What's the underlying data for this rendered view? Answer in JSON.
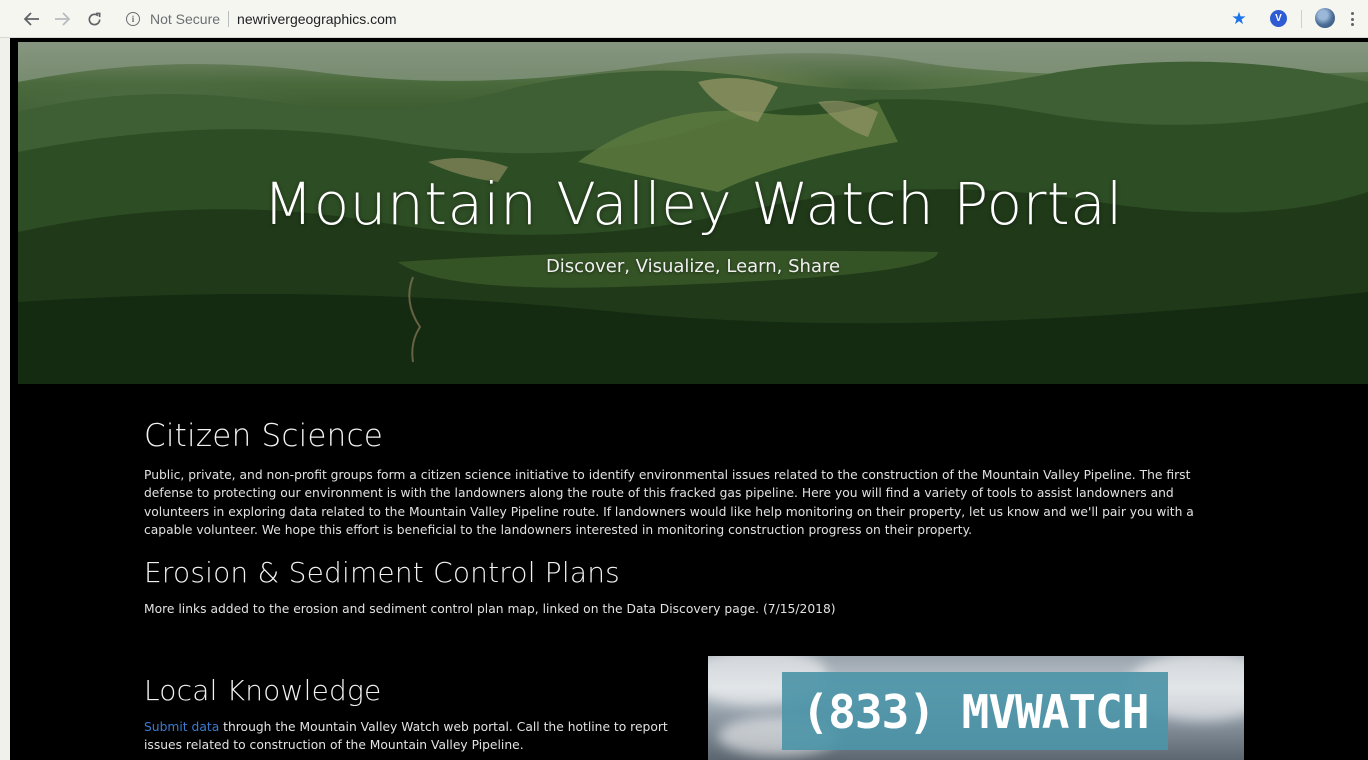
{
  "browser": {
    "security_label": "Not Secure",
    "url": "newrivergeographics.com"
  },
  "hero": {
    "title": "Mountain Valley Watch Portal",
    "subtitle": "Discover, Visualize, Learn, Share"
  },
  "sections": {
    "citizen": {
      "heading": "Citizen Science",
      "body": "Public, private, and non-profit groups form a citizen science initiative to identify environmental issues related to the construction of the Mountain Valley Pipeline. The first defense to protecting our environment is with the landowners along the route of this fracked gas pipeline. Here you will find a variety of tools to assist landowners and volunteers in exploring data related to the Mountain Valley Pipeline route. If landowners would like help monitoring on their property, let us know and we'll pair you with a capable volunteer. We hope this effort is beneficial to the landowners interested in monitoring construction progress on their property."
    },
    "erosion": {
      "heading": "Erosion & Sediment Control Plans",
      "body": "More links added to the erosion and sediment control plan map, linked on the Data Discovery page. (7/15/2018)"
    },
    "local": {
      "heading": "Local Knowledge",
      "link": "Submit data",
      "body": " through the Mountain Valley Watch web portal. Call the hotline to report issues related to construction of the Mountain Valley Pipeline."
    }
  },
  "hotline": {
    "text": "(833) MVWATCH"
  },
  "colors": {
    "page_bg": "#000000",
    "link": "#3b7bd1",
    "hotline_banner": "#4d95a8",
    "star": "#1a73e8"
  },
  "icons": [
    "back-arrow-icon",
    "forward-arrow-icon",
    "reload-icon",
    "info-icon",
    "bookmark-star-icon",
    "extension-icon",
    "profile-avatar",
    "kebab-menu-icon"
  ]
}
